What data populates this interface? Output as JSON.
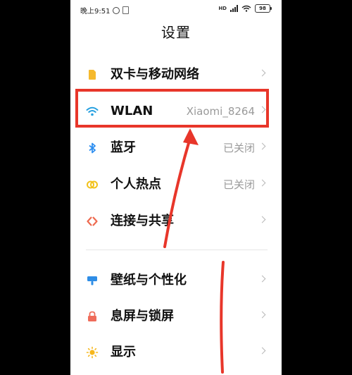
{
  "status_bar": {
    "time": "晚上9:51",
    "hd": "HD",
    "battery": "98"
  },
  "page_title": "设置",
  "items": [
    {
      "label": "双卡与移动网络",
      "value": "",
      "icon": "sim-card-icon",
      "color": "#f5b92e"
    },
    {
      "label": "WLAN",
      "value": "Xiaomi_8264",
      "icon": "wifi-icon",
      "color": "#27a0e0"
    },
    {
      "label": "蓝牙",
      "value": "已关闭",
      "icon": "bluetooth-icon",
      "color": "#2f8ff0"
    },
    {
      "label": "个人热点",
      "value": "已关闭",
      "icon": "hotspot-icon",
      "color": "#f2c21b"
    },
    {
      "label": "连接与共享",
      "value": "",
      "icon": "connection-share-icon",
      "color": "#ee6a4f"
    },
    {
      "label": "壁纸与个性化",
      "value": "",
      "icon": "wallpaper-icon",
      "color": "#2e8de6"
    },
    {
      "label": "息屏与锁屏",
      "value": "",
      "icon": "lock-icon",
      "color": "#ef6c5a"
    },
    {
      "label": "显示",
      "value": "",
      "icon": "brightness-icon",
      "color": "#f6b71d"
    }
  ],
  "annotation": {
    "highlight_color": "#e8362a"
  }
}
